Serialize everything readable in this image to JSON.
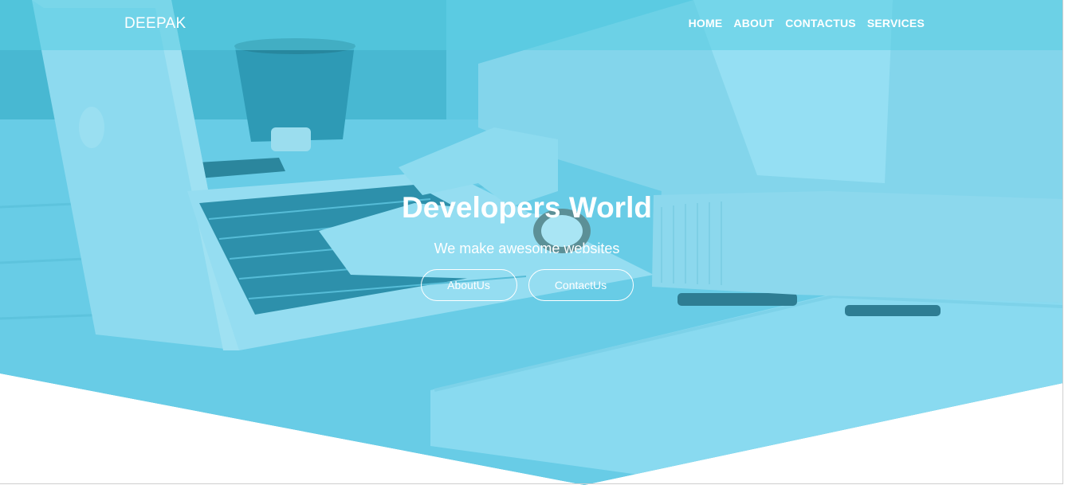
{
  "navbar": {
    "brand": "DEEPAK",
    "links": [
      "HOME",
      "ABOUT",
      "CONTACTUS",
      "SERVICES"
    ]
  },
  "hero": {
    "title": "Developers World",
    "subtitle": "We make awesome websites",
    "buttons": [
      "AboutUs",
      "ContactUs"
    ],
    "background_image": "person-typing-on-laptop-photo",
    "overlay_color": "#46c8eb"
  },
  "colors": {
    "text": "#ffffff",
    "page_background": "#ffffff"
  }
}
